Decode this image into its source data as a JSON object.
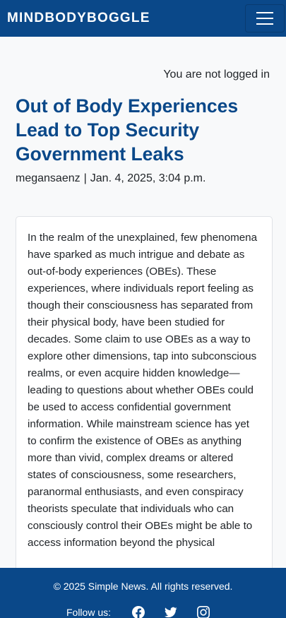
{
  "navbar": {
    "brand": "MINDBODYBOGGLE",
    "toggler_icon": "hamburger-menu-icon",
    "background": "#0a4889"
  },
  "auth": {
    "status": "You are not logged in"
  },
  "article": {
    "title": "Out of Body Experiences Lead to Top Security Government Leaks",
    "author": "megansaenz",
    "separator": "|",
    "date": "Jan. 4, 2025, 3:04 p.m.",
    "body": "In the realm of the unexplained, few phenomena have sparked as much intrigue and debate as out-of-body experiences (OBEs). These experiences, where individuals report feeling as though their consciousness has separated from their physical body, have been studied for decades. Some claim to use OBEs as a way to explore other dimensions, tap into subconscious realms, or even acquire hidden knowledge—leading to questions about whether OBEs could be used to access confidential government information. While mainstream science has yet to confirm the existence of OBEs as anything more than vivid, complex dreams or altered states of consciousness, some researchers, paranormal enthusiasts, and even conspiracy theorists speculate that individuals who can consciously control their OBEs might be able to access information beyond the physical"
  },
  "footer": {
    "copyright": "© 2025 Simple News. All rights reserved.",
    "follow_label": "Follow us:",
    "social_icons": [
      "facebook-icon",
      "twitter-icon",
      "instagram-icon"
    ]
  },
  "colors": {
    "primary": "#0a4889",
    "title": "#0a4889",
    "page_bg": "#f8f9fa",
    "card_bg": "#ffffff"
  }
}
